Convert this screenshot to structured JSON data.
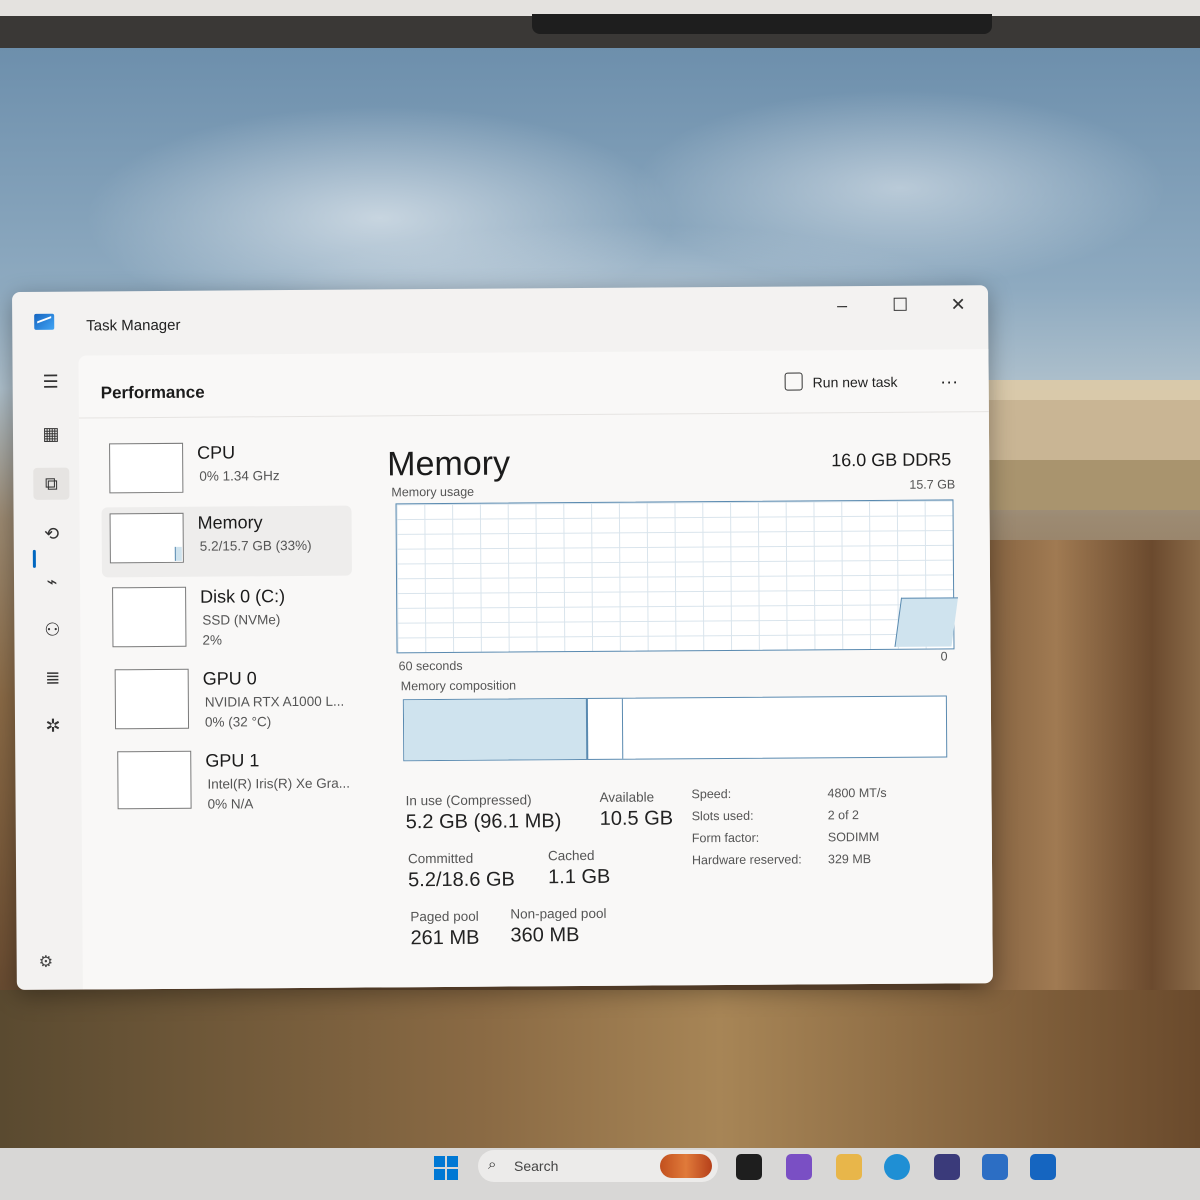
{
  "window": {
    "title": "Task Manager",
    "controls": {
      "minimize": "–",
      "maximize": "☐",
      "close": "✕"
    }
  },
  "nav": {
    "items": [
      {
        "name": "menu",
        "icon": "hamburger-icon",
        "glyph": "☰"
      },
      {
        "name": "processes",
        "icon": "processes-icon",
        "glyph": "▦"
      },
      {
        "name": "performance",
        "icon": "performance-icon",
        "glyph": "⧉",
        "active": true
      },
      {
        "name": "app-history",
        "icon": "history-icon",
        "glyph": "⟲"
      },
      {
        "name": "startup-apps",
        "icon": "startup-icon",
        "glyph": "⌁"
      },
      {
        "name": "users",
        "icon": "users-icon",
        "glyph": "⚇"
      },
      {
        "name": "details",
        "icon": "details-icon",
        "glyph": "≣"
      },
      {
        "name": "services",
        "icon": "services-icon",
        "glyph": "✲"
      }
    ],
    "settings_glyph": "⚙"
  },
  "header": {
    "title": "Performance",
    "run_new_task": "Run new task",
    "more": "..."
  },
  "devices": [
    {
      "name": "CPU",
      "sub": "0%  1.34 GHz",
      "sub2": "",
      "usage": 0.0
    },
    {
      "name": "Memory",
      "sub": "5.2/15.7 GB (33%)",
      "sub2": "",
      "usage": 0.33,
      "selected": true
    },
    {
      "name": "Disk 0 (C:)",
      "sub": "SSD (NVMe)",
      "sub2": "2%",
      "usage": 0.02
    },
    {
      "name": "GPU 0",
      "sub": "NVIDIA RTX A1000 L...",
      "sub2": "0%  (32 °C)",
      "usage": 0.0
    },
    {
      "name": "GPU 1",
      "sub": "Intel(R) Iris(R) Xe Gra...",
      "sub2": "0% N/A",
      "usage": 0.0
    }
  ],
  "memory": {
    "title": "Memory",
    "spec": "16.0 GB DDR5",
    "usage_label": "Memory usage",
    "usage_max": "15.7 GB",
    "time_span": "60 seconds",
    "time_end": "0",
    "composition_label": "Memory composition",
    "usage_fraction": 0.33,
    "stats": {
      "in_use_label": "In use (Compressed)",
      "in_use_value": "5.2 GB (96.1 MB)",
      "available_label": "Available",
      "available_value": "10.5 GB",
      "committed_label": "Committed",
      "committed_value": "5.2/18.6 GB",
      "cached_label": "Cached",
      "cached_value": "1.1 GB",
      "paged_label": "Paged pool",
      "paged_value": "261 MB",
      "nonpaged_label": "Non-paged pool",
      "nonpaged_value": "360 MB"
    },
    "specs": [
      {
        "label": "Speed:",
        "value": "4800 MT/s"
      },
      {
        "label": "Slots used:",
        "value": "2 of 2"
      },
      {
        "label": "Form factor:",
        "value": "SODIMM"
      },
      {
        "label": "Hardware reserved:",
        "value": "329 MB"
      }
    ]
  },
  "taskbar": {
    "search_placeholder": "Search",
    "search_glyph": "⌕",
    "app_colors": [
      "#1e1e1e",
      "#7a4fc4",
      "#e8b64a",
      "#1f8fd4",
      "#3a3a7a",
      "#2c6ec4",
      "#1565c0"
    ]
  }
}
